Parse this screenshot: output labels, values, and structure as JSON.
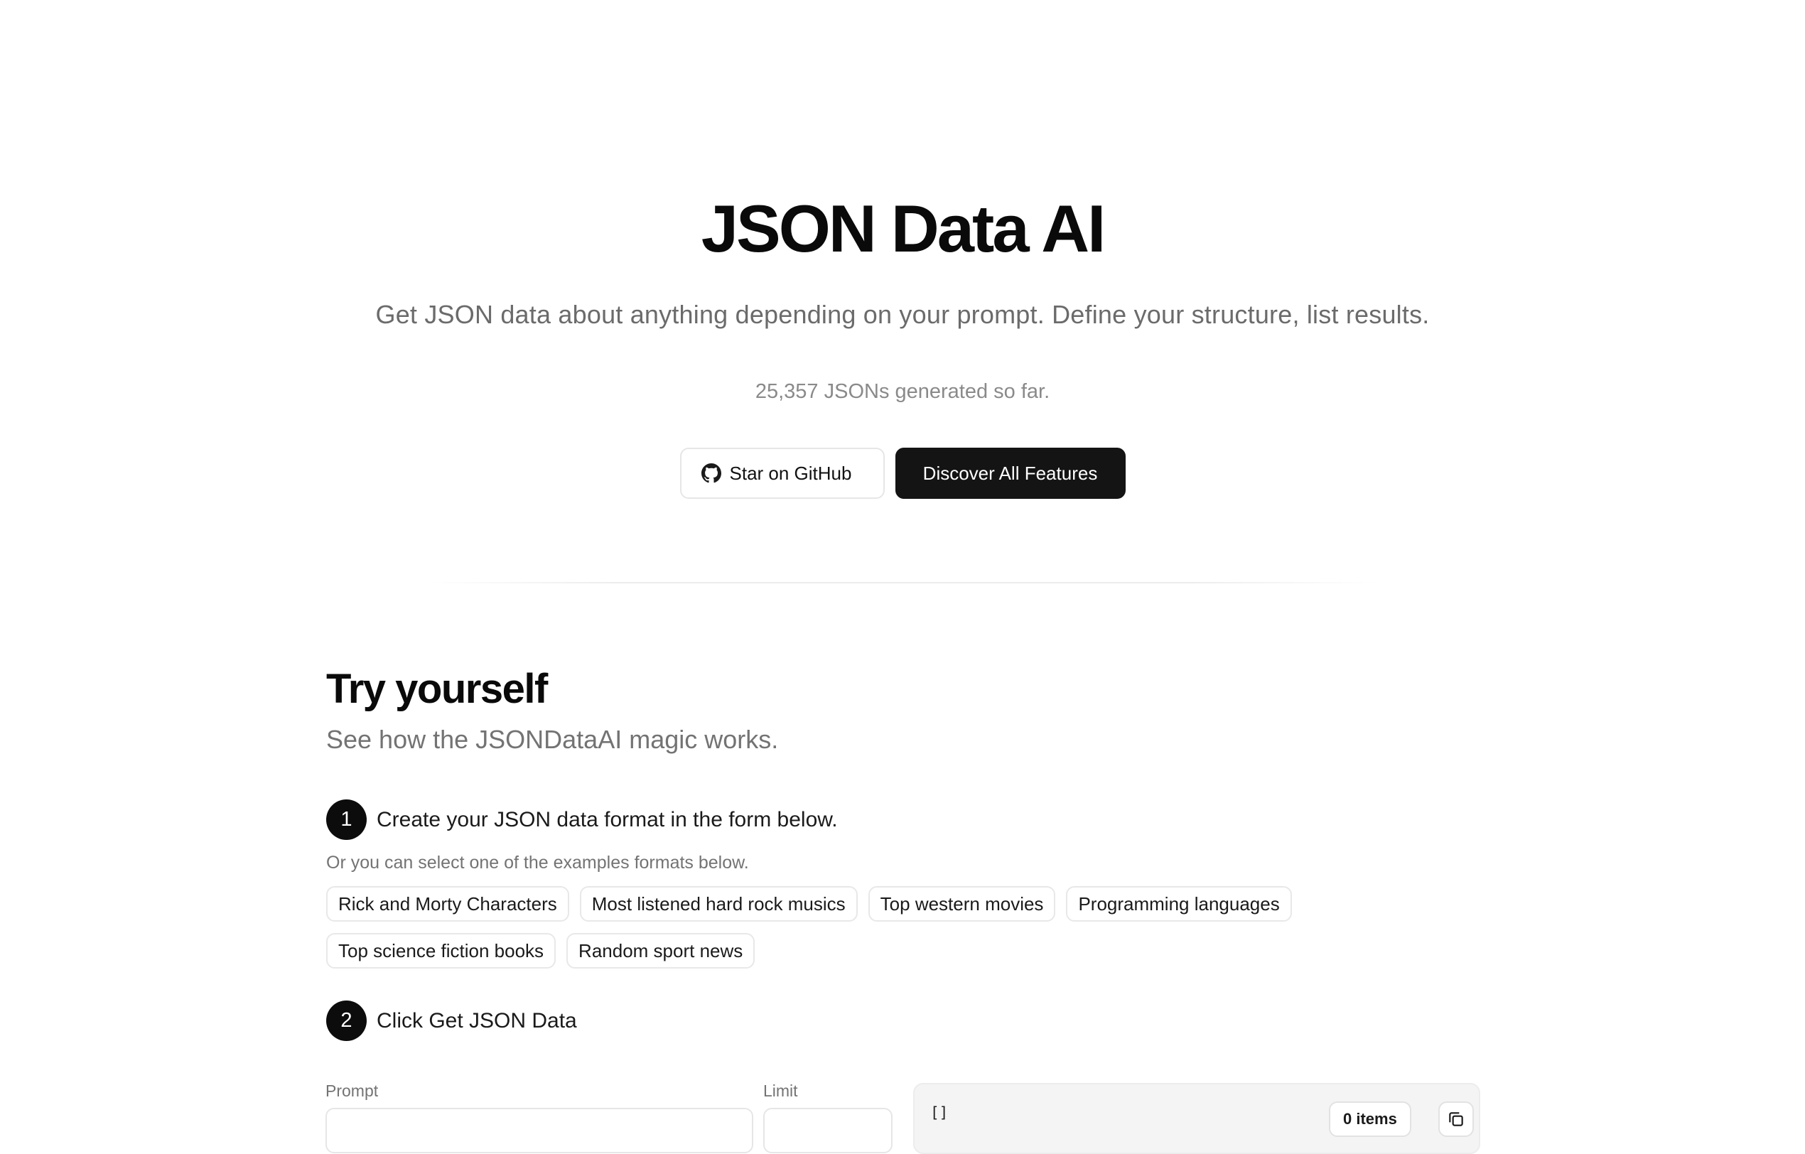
{
  "hero": {
    "title": "JSON Data AI",
    "subtitle": "Get JSON data about anything depending on your prompt. Define your structure, list results.",
    "counter_text": "25,357 JSONs generated so far.",
    "github_button_label": "Star on GitHub",
    "features_button_label": "Discover All Features"
  },
  "try_section": {
    "title": "Try yourself",
    "subtitle": "See how the JSONDataAI magic works.",
    "step1": {
      "number": "1",
      "text": "Create your JSON data format in the form below."
    },
    "examples_hint": "Or you can select one of the examples formats below.",
    "examples": [
      "Rick and Morty Characters",
      "Most listened hard rock musics",
      "Top western movies",
      "Programming languages",
      "Top science fiction books",
      "Random sport news"
    ],
    "step2": {
      "number": "2",
      "text": "Click Get JSON Data"
    }
  },
  "form": {
    "prompt_label": "Prompt",
    "prompt_value": "",
    "limit_label": "Limit",
    "limit_value": ""
  },
  "output": {
    "code": "[]",
    "items_count_label": "0 items"
  },
  "icons": {
    "github": "github-icon",
    "copy": "copy-icon"
  },
  "colors": {
    "primary": "#141414",
    "muted_text": "#737373",
    "border": "#e6e6e6",
    "panel_bg": "#f4f4f4"
  }
}
